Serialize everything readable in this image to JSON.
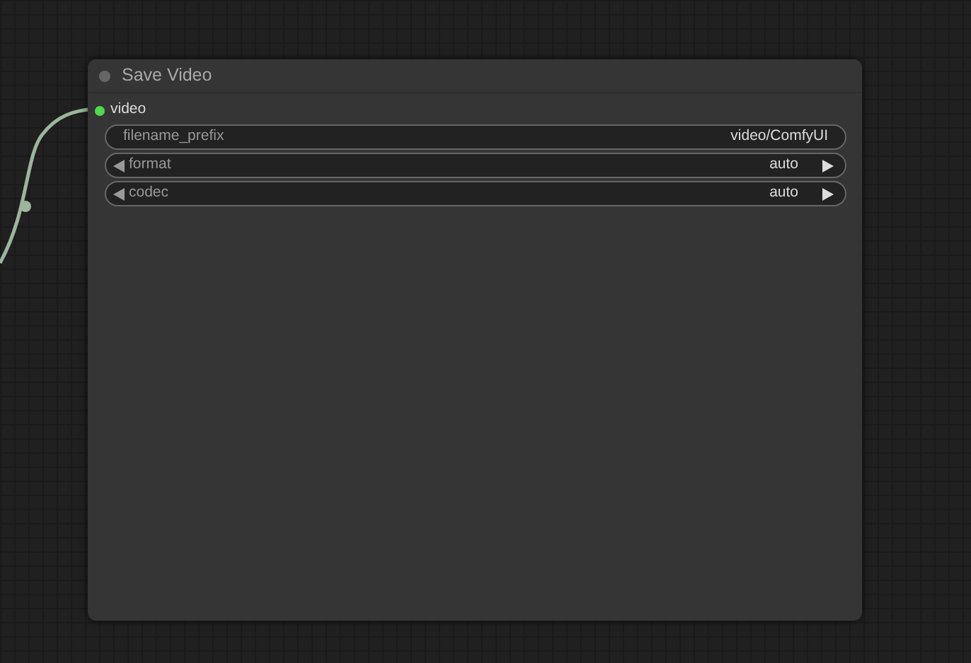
{
  "node": {
    "title": "Save Video",
    "inputs": [
      {
        "label": "video",
        "connected": true
      }
    ],
    "widgets": [
      {
        "kind": "text",
        "name": "filename_prefix",
        "value": "video/ComfyUI"
      },
      {
        "kind": "combo",
        "name": "format",
        "value": "auto"
      },
      {
        "kind": "combo",
        "name": "codec",
        "value": "auto"
      }
    ]
  }
}
